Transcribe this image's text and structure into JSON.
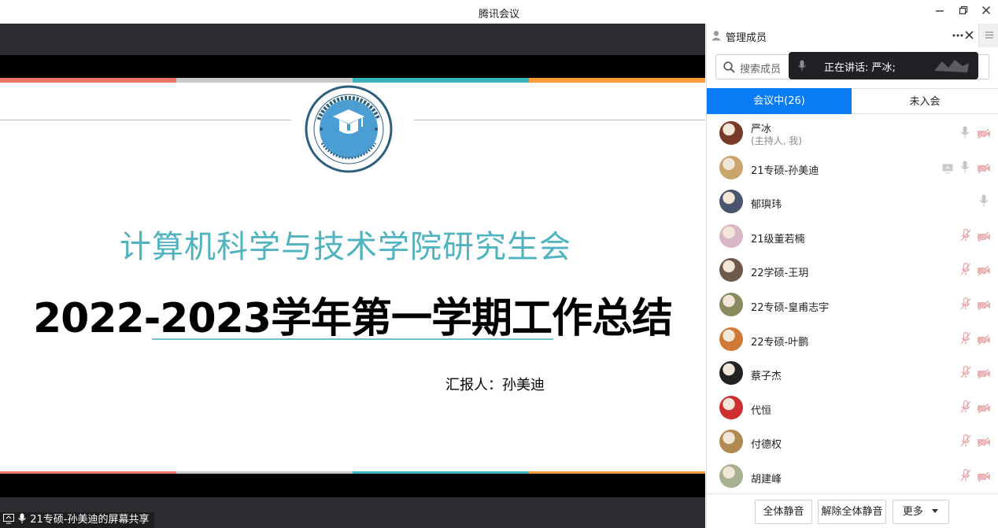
{
  "window": {
    "title": "腾讯会议"
  },
  "slide": {
    "subtitle": "计算机科学与技术学院研究生会",
    "title": "2022-2023学年第一学期工作总结",
    "reporter": "汇报人：孙美迪",
    "colors": [
      "#ee7667",
      "#c9c9c9",
      "#38b3bf",
      "#fd9b35"
    ]
  },
  "share_label": "21专硕-孙美迪的屏幕共享",
  "panel": {
    "header": "管理成员",
    "search_placeholder": "搜索成员",
    "speaking_notice": "正在讲话: 严冰;",
    "tabs": [
      {
        "label": "会议中(26)",
        "active": true
      },
      {
        "label": "未入会",
        "active": false
      }
    ],
    "members": [
      {
        "name": "严冰",
        "role": "(主持人, 我)",
        "mic": "on",
        "cam": "off",
        "share": false
      },
      {
        "name": "21专硕-孙美迪",
        "role": "",
        "mic": "on",
        "cam": "off",
        "share": true
      },
      {
        "name": "郁璵玮",
        "role": "",
        "mic": "on",
        "cam": "none",
        "share": false
      },
      {
        "name": "21级董若楠",
        "role": "",
        "mic": "muted",
        "cam": "off",
        "share": false
      },
      {
        "name": "22学硕-王玥",
        "role": "",
        "mic": "muted",
        "cam": "off",
        "share": false
      },
      {
        "name": "22专硕-皇甫志宇",
        "role": "",
        "mic": "muted",
        "cam": "off",
        "share": false
      },
      {
        "name": "22专硕-叶鹏",
        "role": "",
        "mic": "muted",
        "cam": "off",
        "share": false
      },
      {
        "name": "蔡子杰",
        "role": "",
        "mic": "muted",
        "cam": "off",
        "share": false
      },
      {
        "name": "代恒",
        "role": "",
        "mic": "muted",
        "cam": "off",
        "share": false
      },
      {
        "name": "付德权",
        "role": "",
        "mic": "muted",
        "cam": "off",
        "share": false
      },
      {
        "name": "胡建峰",
        "role": "",
        "mic": "muted",
        "cam": "off",
        "share": false
      }
    ],
    "footer": {
      "mute_all": "全体静音",
      "unmute_all": "解除全体静音",
      "more": "更多"
    }
  }
}
